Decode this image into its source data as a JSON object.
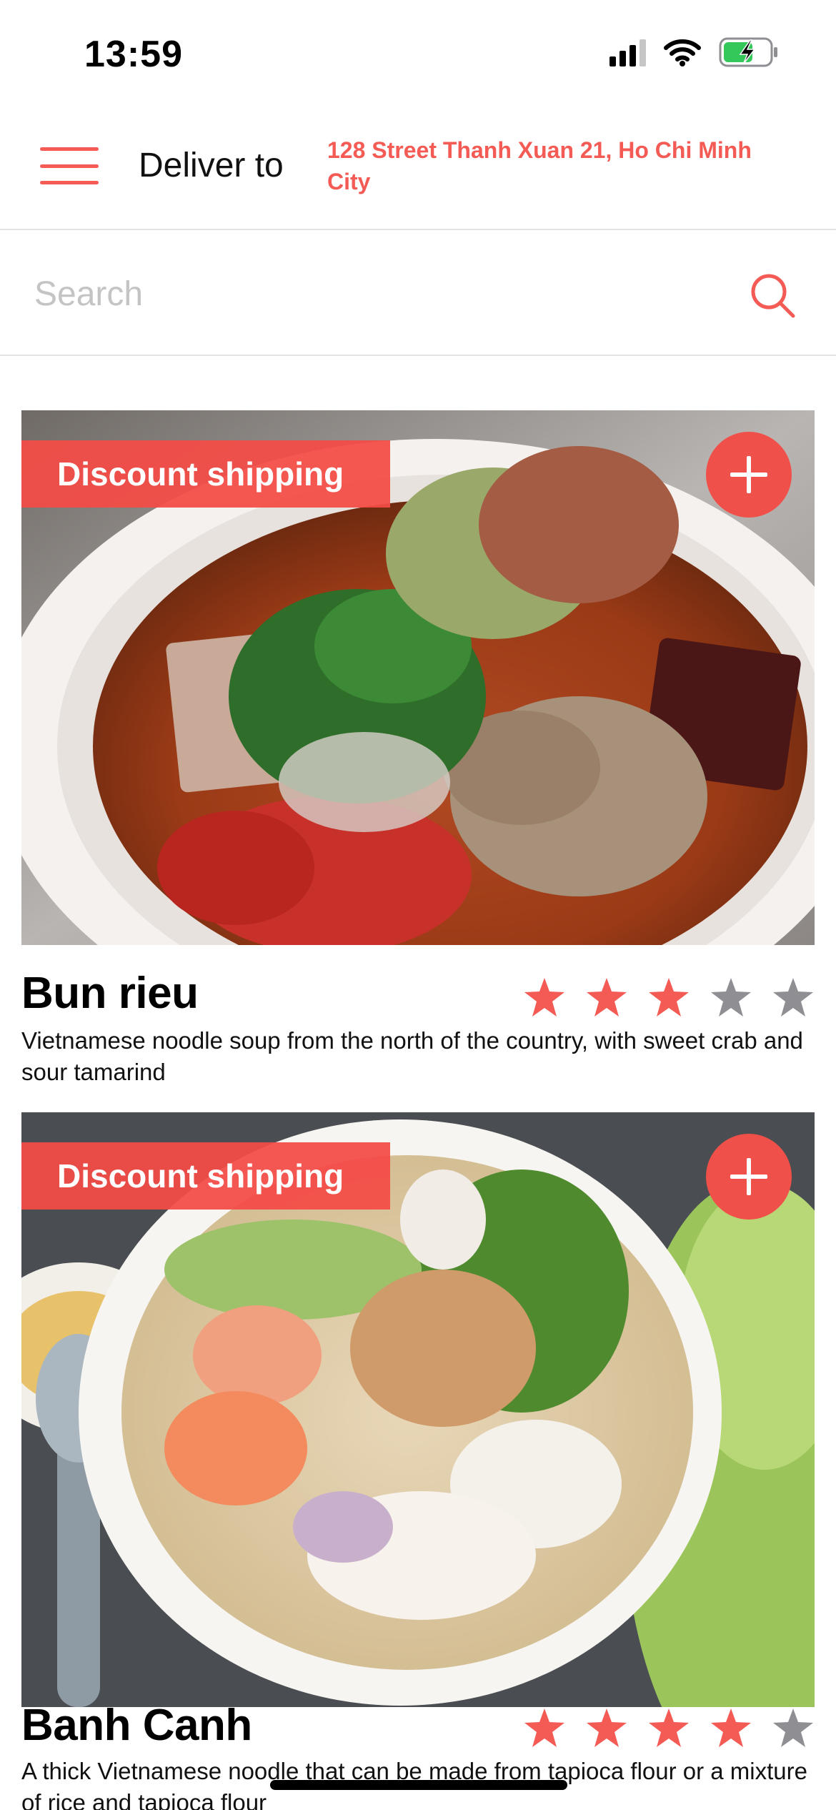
{
  "status_bar": {
    "time": "13:59"
  },
  "header": {
    "deliver_label": "Deliver to",
    "address": "128 Street Thanh Xuan 21, Ho Chi Minh City"
  },
  "search": {
    "placeholder": "Search"
  },
  "colors": {
    "accent": "#f45b55",
    "star_active": "#f45b55",
    "star_inactive": "#8e8e93"
  },
  "items": [
    {
      "badge": "Discount shipping",
      "name": "Bun rieu",
      "description": "Vietnamese noodle soup from the north of the country, with sweet crab and sour tamarind",
      "rating": 3,
      "rating_max": 5
    },
    {
      "badge": "Discount shipping",
      "name": "Banh Canh",
      "description": "A thick Vietnamese noodle that can be made from tapioca flour or a mixture of rice and tapioca flour",
      "rating": 4,
      "rating_max": 5
    }
  ]
}
